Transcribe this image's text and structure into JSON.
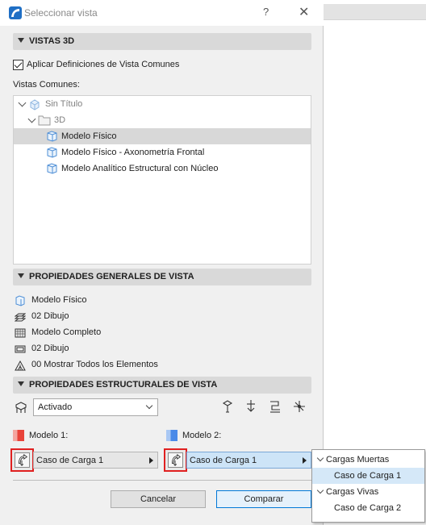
{
  "window": {
    "title": "Seleccionar vista",
    "help_glyph": "?",
    "close_glyph": "✕"
  },
  "sections": {
    "vistas_3d": "VISTAS 3D",
    "propiedades_generales": "PROPIEDADES GENERALES DE VISTA",
    "propiedades_estructurales": "PROPIEDADES ESTRUCTURALES DE VISTA"
  },
  "common_defs": {
    "checkbox_label": "Aplicar Definiciones de Vista Comunes",
    "checked": true,
    "list_label": "Vistas Comunes:"
  },
  "tree": {
    "root": "Sin Título",
    "folder": "3D",
    "items": [
      {
        "label": "Modelo Físico",
        "selected": true
      },
      {
        "label": "Modelo Físico - Axonometría Frontal",
        "selected": false
      },
      {
        "label": "Modelo Analítico Estructural con Núcleo",
        "selected": false
      }
    ]
  },
  "general_props": [
    {
      "icon": "model-view-icon",
      "label": "Modelo Físico"
    },
    {
      "icon": "layers-icon",
      "label": "02 Dibujo"
    },
    {
      "icon": "model-display-icon",
      "label": "Modelo Completo"
    },
    {
      "icon": "pen-set-icon",
      "label": "02 Dibujo"
    },
    {
      "icon": "renovation-filter-icon",
      "label": "00 Mostrar Todos los Elementos"
    }
  ],
  "structural": {
    "dropdown_value": "Activado",
    "model1_label": "Modelo 1:",
    "model2_label": "Modelo 2:",
    "model1_value": "Caso de Carga 1",
    "model2_value": "Caso de Carga 1",
    "model1_color": "#e8433a",
    "model2_color": "#4a8ae8"
  },
  "buttons": {
    "cancel": "Cancelar",
    "compare": "Comparar"
  },
  "popup_menu": {
    "groups": [
      {
        "label": "Cargas Muertas",
        "items": [
          "Caso de Carga 1"
        ]
      },
      {
        "label": "Cargas Vivas",
        "items": [
          "Caso de Carga 2"
        ]
      }
    ],
    "highlighted": "Caso de Carga 1"
  }
}
